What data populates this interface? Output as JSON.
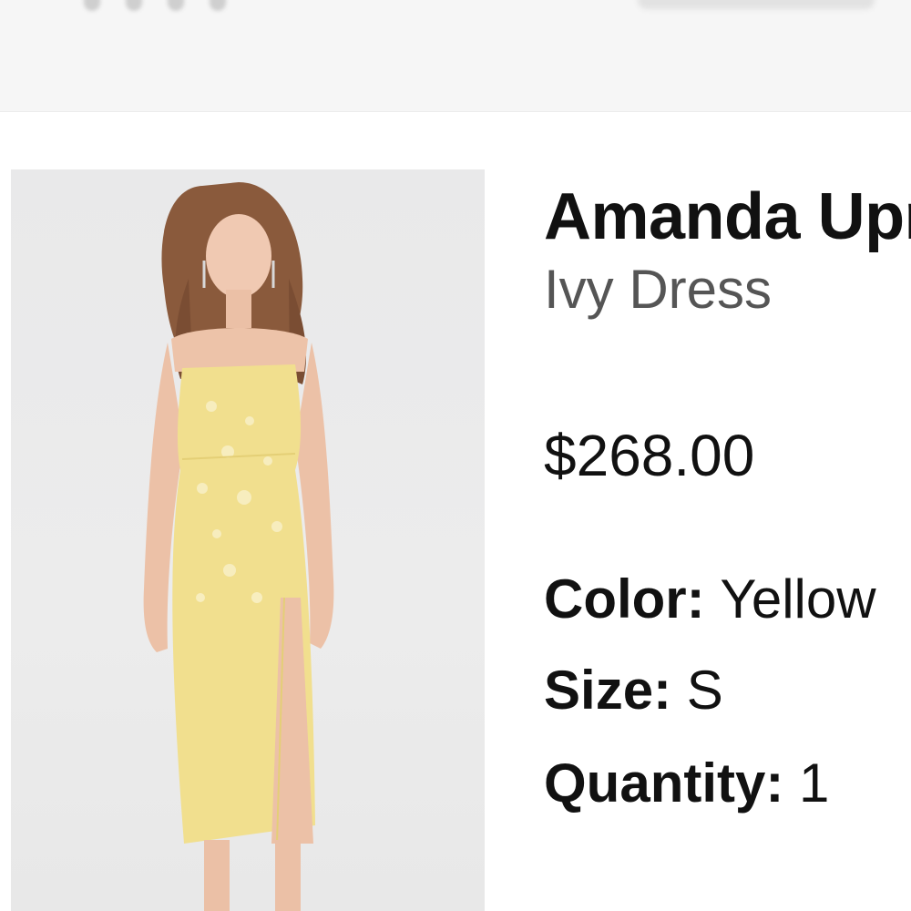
{
  "product": {
    "brand": "Amanda Uprichard",
    "name": "Ivy Dress",
    "price": "$268.00",
    "image_alt": "Model wearing a yellow strapless floral jacquard midi dress with front slit"
  },
  "attributes": {
    "color_label": "Color:",
    "color_value": "Yellow",
    "size_label": "Size:",
    "size_value": "S",
    "quantity_label": "Quantity:",
    "quantity_value": "1"
  },
  "colors": {
    "dress": "#f1df8e",
    "background": "#e9e9ea",
    "text": "#111111",
    "subtext": "#555555"
  }
}
